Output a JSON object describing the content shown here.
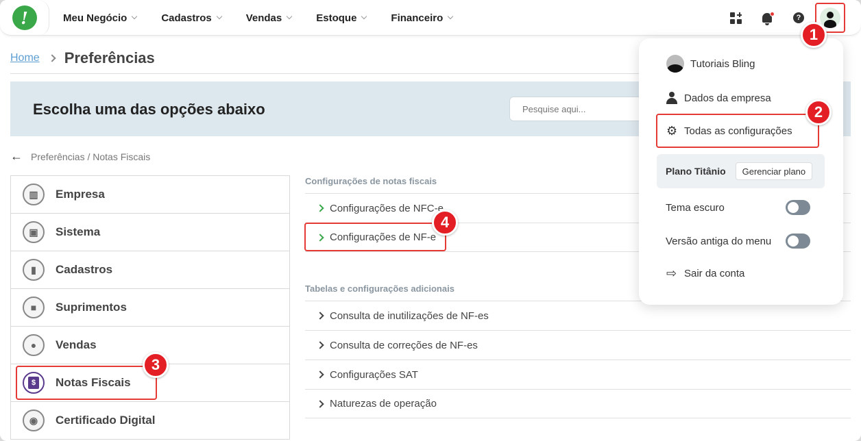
{
  "nav": {
    "logo_text": "!",
    "items": [
      {
        "label": "Meu Negócio"
      },
      {
        "label": "Cadastros"
      },
      {
        "label": "Vendas"
      },
      {
        "label": "Estoque"
      },
      {
        "label": "Financeiro"
      }
    ]
  },
  "topbar_icons": [
    "apps-icon",
    "bell-icon",
    "help-icon",
    "avatar-icon"
  ],
  "help_glyph": "?",
  "breadcrumb": {
    "home": "Home",
    "current": "Preferências"
  },
  "banner": {
    "title": "Escolha uma das opções abaixo",
    "search_placeholder": "Pesquise aqui..."
  },
  "back": {
    "text": "Preferências / Notas Fiscais"
  },
  "left_menu": [
    {
      "label": "Empresa"
    },
    {
      "label": "Sistema"
    },
    {
      "label": "Cadastros"
    },
    {
      "label": "Suprimentos"
    },
    {
      "label": "Vendas"
    },
    {
      "label": "Notas Fiscais",
      "active_glyph": "$"
    },
    {
      "label": "Certificado Digital"
    }
  ],
  "section1": {
    "title": "Configurações de notas fiscais",
    "items": [
      {
        "label": "Configurações de NFC-e"
      },
      {
        "label": "Configurações de NF-e"
      }
    ]
  },
  "section2": {
    "title": "Tabelas e configurações adicionais",
    "items": [
      {
        "label": "Consulta de inutilizações de NF-es"
      },
      {
        "label": "Consulta de correções de NF-es"
      },
      {
        "label": "Configurações SAT"
      },
      {
        "label": "Naturezas de operação"
      }
    ]
  },
  "dropdown": {
    "user": "Tutoriais Bling",
    "company": "Dados da empresa",
    "all_settings": "Todas as configurações",
    "plan_name": "Plano Titânio",
    "plan_button": "Gerenciar plano",
    "dark_theme": "Tema escuro",
    "old_menu": "Versão antiga do menu",
    "logout": "Sair da conta"
  },
  "accent_colors": {
    "brand_green": "#3aa849",
    "highlight_red": "#e53935",
    "active_purple": "#5a3a8c"
  },
  "annotations": [
    "1",
    "2",
    "3",
    "4"
  ]
}
